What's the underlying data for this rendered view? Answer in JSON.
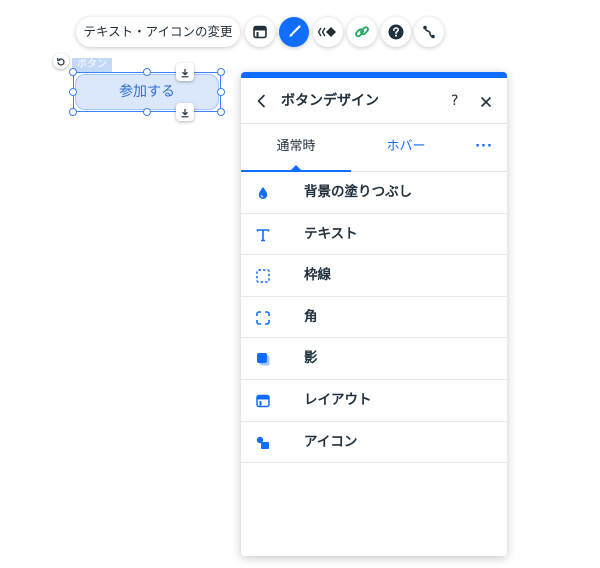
{
  "toolbar": {
    "change_text_icon_label": "テキスト・アイコンの変更",
    "tools": [
      {
        "name": "layout-icon"
      },
      {
        "name": "design-brush-icon",
        "active": true
      },
      {
        "name": "animation-icon"
      },
      {
        "name": "link-icon"
      },
      {
        "name": "help-icon"
      },
      {
        "name": "connect-icon"
      }
    ]
  },
  "canvas": {
    "selection_tag": "ボタン",
    "button_label": "参加する"
  },
  "panel": {
    "title": "ボタンデザイン",
    "help_label": "?",
    "tabs": {
      "normal": "通常時",
      "hover": "ホバー",
      "more": "···"
    },
    "items": [
      {
        "label": "背景の塗りつぶし",
        "icon": "fill-drop-icon"
      },
      {
        "label": "テキスト",
        "icon": "text-icon"
      },
      {
        "label": "枠線",
        "icon": "border-icon"
      },
      {
        "label": "角",
        "icon": "corners-icon"
      },
      {
        "label": "影",
        "icon": "shadow-icon"
      },
      {
        "label": "レイアウト",
        "icon": "layout-icon"
      },
      {
        "label": "アイコン",
        "icon": "icon-shape-icon"
      }
    ]
  },
  "colors": {
    "accent": "#116dff",
    "text": "#20303c",
    "link_green": "#25a55f",
    "canvas_button_bg": "#dbe8fc",
    "canvas_button_text": "#2f6fd6"
  }
}
